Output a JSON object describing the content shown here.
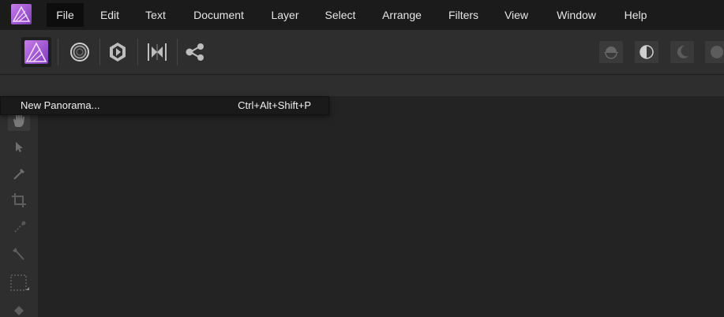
{
  "menubar": {
    "items": [
      {
        "label": "File",
        "active": true
      },
      {
        "label": "Edit"
      },
      {
        "label": "Text"
      },
      {
        "label": "Document"
      },
      {
        "label": "Layer"
      },
      {
        "label": "Select"
      },
      {
        "label": "Arrange"
      },
      {
        "label": "Filters"
      },
      {
        "label": "View"
      },
      {
        "label": "Window"
      },
      {
        "label": "Help"
      }
    ]
  },
  "toolbar": {
    "personas": [
      {
        "icon": "photo-persona-icon",
        "active": true
      },
      {
        "icon": "liquify-persona-icon"
      },
      {
        "icon": "develop-persona-icon"
      },
      {
        "icon": "tone-mapping-persona-icon"
      },
      {
        "icon": "export-persona-icon"
      }
    ],
    "right_buttons": [
      {
        "icon": "flip-icon"
      },
      {
        "icon": "contrast-icon"
      },
      {
        "icon": "moon-icon"
      },
      {
        "icon": "circle-icon"
      }
    ]
  },
  "tools": [
    {
      "icon": "hand-icon",
      "selected": true
    },
    {
      "icon": "move-arrow-icon"
    },
    {
      "icon": "color-picker-icon"
    },
    {
      "icon": "crop-icon"
    },
    {
      "icon": "selection-brush-icon"
    },
    {
      "icon": "flood-select-icon"
    },
    {
      "icon": "marquee-icon"
    },
    {
      "icon": "fill-icon"
    }
  ],
  "dropdown": {
    "items": [
      {
        "label": "New Panorama...",
        "shortcut": "Ctrl+Alt+Shift+P"
      }
    ]
  },
  "colors": {
    "accent_purple": "#b65fd6",
    "menubar_bg": "#1b1b1b",
    "panel_bg": "#2e2e2e",
    "canvas_bg": "#232323"
  }
}
